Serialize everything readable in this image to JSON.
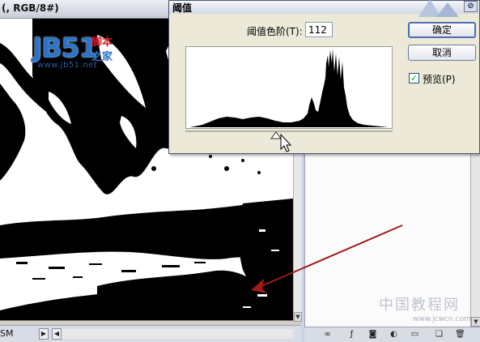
{
  "document": {
    "title": "(, RGB/8#)",
    "status_zoom": "SM"
  },
  "logo": {
    "text": "JB51",
    "cn_line1": "脚本",
    "cn_line2": "之家",
    "url": "www.jb51.net"
  },
  "dialog": {
    "title": "阈值",
    "threshold_label": "阈值色阶(T):",
    "threshold_value": "112",
    "ok_label": "确定",
    "cancel_label": "取消",
    "preview_label": "预览(P)",
    "preview_checked": true
  },
  "watermark": {
    "text": "中国教程网",
    "url": "www.jcwcn.com"
  },
  "colors": {
    "logo_blue": "#2c74c9",
    "logo_red": "#d61f2e",
    "arrow_red": "#a11a1a"
  }
}
